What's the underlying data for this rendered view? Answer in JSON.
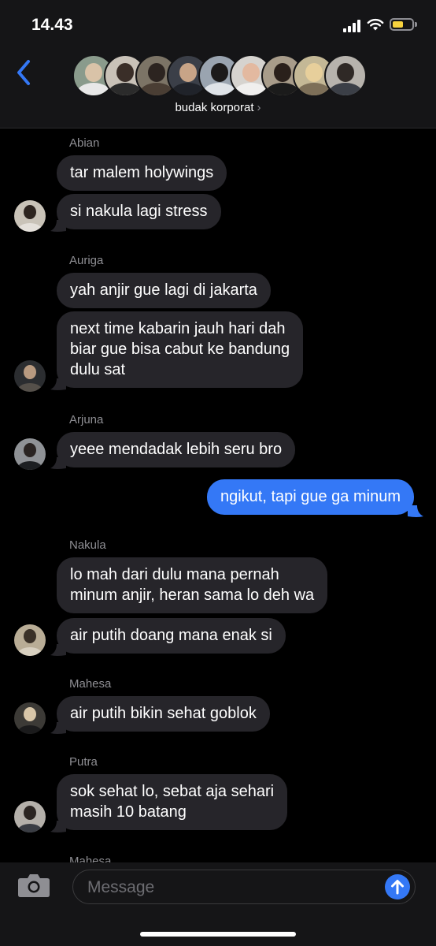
{
  "status_bar": {
    "time": "14.43"
  },
  "header": {
    "group_name": "budak korporat",
    "chevron": "›"
  },
  "messages": {
    "g1": {
      "sender": "Abian",
      "m1": "tar malem holywings",
      "m2": "si nakula lagi stress"
    },
    "g2": {
      "sender": "Auriga",
      "m1": "yah anjir gue lagi di jakarta",
      "m2": "next time kabarin jauh hari dah\nbiar gue bisa cabut ke bandung\ndulu sat"
    },
    "g3": {
      "sender": "Arjuna",
      "m1": "yeee mendadak lebih seru bro"
    },
    "out1": "ngikut, tapi gue ga minum",
    "g4": {
      "sender": "Nakula",
      "m1": "lo mah dari dulu mana pernah\nminum anjir, heran sama lo deh wa",
      "m2": "air putih doang mana enak si"
    },
    "g5": {
      "sender": "Mahesa",
      "m1": "air putih bikin sehat goblok"
    },
    "g6": {
      "sender": "Putra",
      "m1": "sok sehat lo, sebat aja sehari\nmasih 10 batang"
    },
    "g7": {
      "sender": "Mahesa"
    }
  },
  "input": {
    "placeholder": "Message"
  },
  "icons": {
    "back": "chevron-left-icon",
    "camera": "camera-icon",
    "send": "arrow-up-icon",
    "signal": "cellular-signal-icon",
    "wifi": "wifi-icon",
    "battery": "battery-icon"
  },
  "colors": {
    "accent": "#3478f6",
    "incoming_bubble": "#26252a",
    "battery": "#f7d23e",
    "secondary_text": "#8e8e93"
  }
}
